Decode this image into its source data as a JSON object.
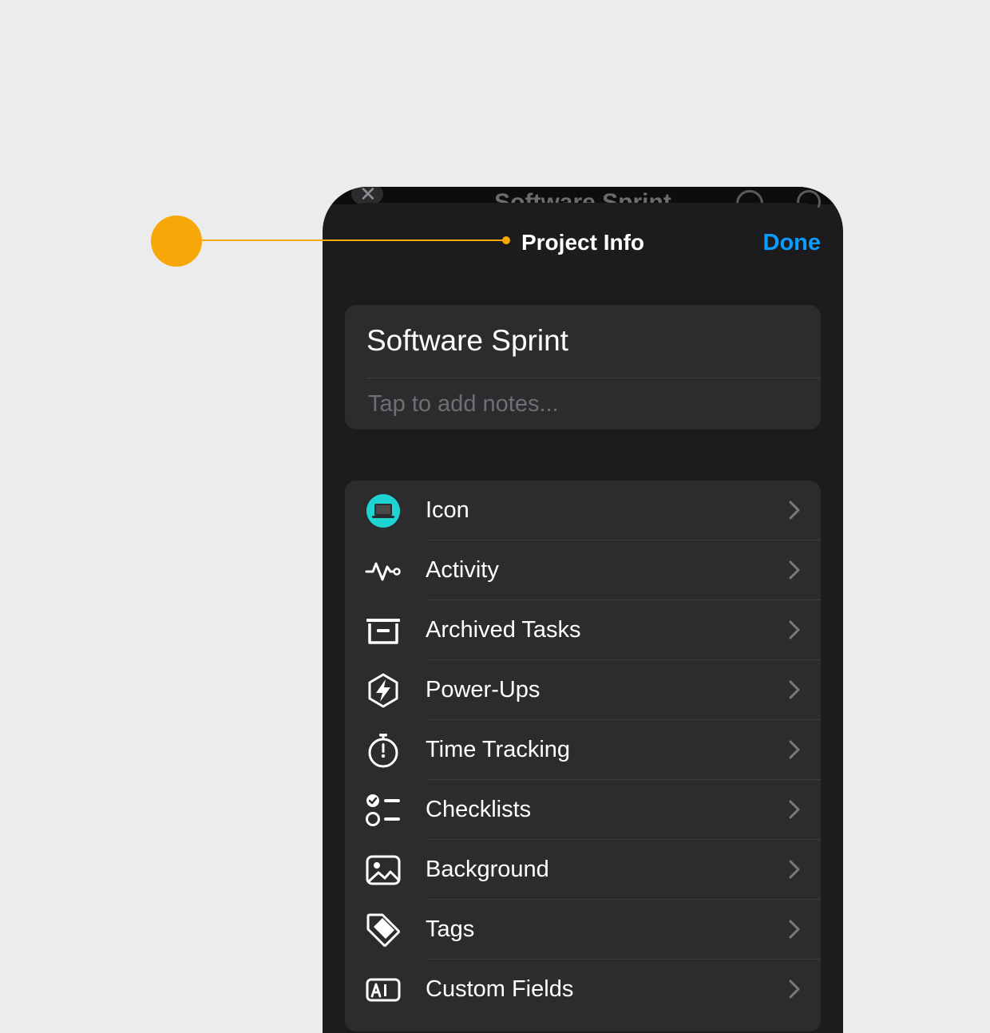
{
  "behind_header": {
    "title": "Software Sprint",
    "close_glyph": "✕"
  },
  "sheet": {
    "title": "Project Info",
    "done_label": "Done"
  },
  "project": {
    "name": "Software Sprint",
    "notes_placeholder": "Tap to add notes..."
  },
  "menu": {
    "items": [
      {
        "label": "Icon",
        "icon": "laptop-badge-icon"
      },
      {
        "label": "Activity",
        "icon": "activity-pulse-icon"
      },
      {
        "label": "Archived Tasks",
        "icon": "archive-box-icon"
      },
      {
        "label": "Power-Ups",
        "icon": "power-ups-bolt-icon"
      },
      {
        "label": "Time Tracking",
        "icon": "stopwatch-icon"
      },
      {
        "label": "Checklists",
        "icon": "checklist-icon"
      },
      {
        "label": "Background",
        "icon": "image-icon"
      },
      {
        "label": "Tags",
        "icon": "tag-icon"
      },
      {
        "label": "Custom Fields",
        "icon": "custom-fields-icon"
      }
    ]
  },
  "colors": {
    "callout": "#f7a808",
    "accent": "#0a9dff",
    "icon_badge": "#1fd3d3",
    "sheet_bg": "#1c1c1e",
    "card_bg": "#2c2c2e"
  }
}
